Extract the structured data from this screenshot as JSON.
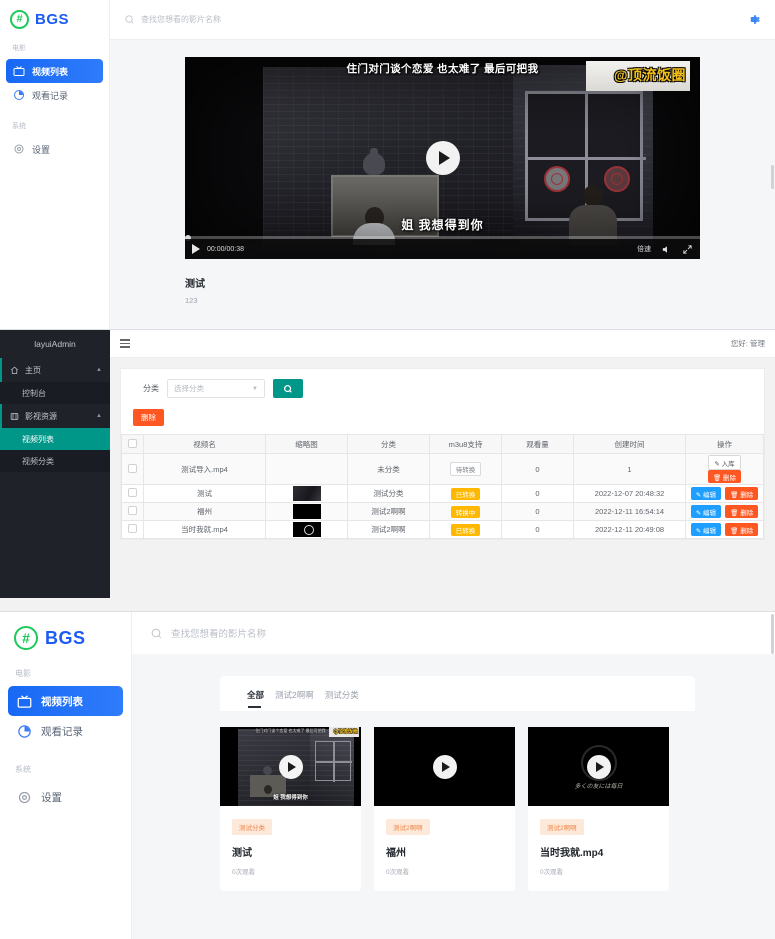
{
  "frontend_detail": {
    "brand": {
      "mark": "#",
      "name": "BGS"
    },
    "sidebar": {
      "groups": [
        {
          "label": "电影",
          "items": [
            {
              "label": "视频列表",
              "icon": "tv-icon",
              "active": true
            },
            {
              "label": "观看记录",
              "icon": "history-pie-icon",
              "active": false
            }
          ]
        },
        {
          "label": "系统",
          "items": [
            {
              "label": "设置",
              "icon": "gear-icon",
              "active": false
            }
          ]
        }
      ]
    },
    "search": {
      "placeholder": "查找您想看的影片名称",
      "icon": "search-icon"
    },
    "settings_icon": "gear-icon",
    "player": {
      "subtitle_top": "住门对门谈个恋爱 也太难了 最后可把我",
      "watermark": "@顶流饭圈",
      "subtitle_bottom": "姐 我想得到你",
      "time": "00:00/00:38",
      "rate_label": "倍速",
      "volume_label": "0",
      "play_icon": "play-icon",
      "volume_icon": "volume-icon",
      "fullscreen_icon": "fullscreen-icon"
    },
    "video": {
      "title": "测试",
      "description": "123"
    }
  },
  "admin": {
    "logo": "layuiAdmin",
    "greeting": "您好: 管理",
    "menu": [
      {
        "label": "主页",
        "icon": "home-icon",
        "expanded": true,
        "children": [
          {
            "label": "控制台",
            "active": false
          }
        ]
      },
      {
        "label": "影视资源",
        "icon": "film-icon",
        "expanded": true,
        "children": [
          {
            "label": "视频列表",
            "active": true
          },
          {
            "label": "视频分类",
            "active": false
          }
        ]
      }
    ],
    "filter": {
      "label": "分类",
      "select_placeholder": "选择分类",
      "search_icon": "search-icon",
      "delete_label": "删除"
    },
    "table": {
      "columns": [
        "视频名",
        "缩略图",
        "分类",
        "m3u8支持",
        "观看量",
        "创建时间",
        "操作"
      ],
      "rows": [
        {
          "name": "测试导入.mp4",
          "thumb": "none",
          "category": "未分类",
          "m3u8": "待转换",
          "m3u8_state": "gray",
          "views": "0",
          "created": "1",
          "action_primary": "入库",
          "action_primary_style": "white",
          "action_delete": "删除"
        },
        {
          "name": "测试",
          "thumb": "scene",
          "category": "测试分类",
          "m3u8": "已转换",
          "m3u8_state": "warn",
          "views": "0",
          "created": "2022-12-07 20:48:32",
          "action_primary": "编辑",
          "action_primary_style": "blue",
          "action_delete": "删除"
        },
        {
          "name": "福州",
          "thumb": "black",
          "category": "测试2啊啊",
          "m3u8": "转换中",
          "m3u8_state": "warn",
          "views": "0",
          "created": "2022-12-11 16:54:14",
          "action_primary": "编辑",
          "action_primary_style": "blue",
          "action_delete": "删除"
        },
        {
          "name": "当时我就.mp4",
          "thumb": "ring",
          "category": "测试2啊啊",
          "m3u8": "已转换",
          "m3u8_state": "warn",
          "views": "0",
          "created": "2022-12-11 20:49:08",
          "action_primary": "编辑",
          "action_primary_style": "blue",
          "action_delete": "删除"
        }
      ]
    }
  },
  "frontend_list": {
    "brand": {
      "mark": "#",
      "name": "BGS"
    },
    "sidebar": {
      "groups": [
        {
          "label": "电影",
          "items": [
            {
              "label": "视频列表",
              "icon": "tv-icon",
              "active": true
            },
            {
              "label": "观看记录",
              "icon": "history-pie-icon",
              "active": false
            }
          ]
        },
        {
          "label": "系统",
          "items": [
            {
              "label": "设置",
              "icon": "gear-icon",
              "active": false
            }
          ]
        }
      ]
    },
    "search": {
      "placeholder": "查找您想看的影片名称",
      "icon": "search-icon"
    },
    "tabs": [
      {
        "label": "全部",
        "active": true
      },
      {
        "label": "测试2啊啊",
        "active": false
      },
      {
        "label": "测试分类",
        "active": false
      }
    ],
    "cards": [
      {
        "tag": "测试分类",
        "title": "测试",
        "views": "0次观看",
        "thumb": "scene",
        "sub_top": "住门对门谈个恋爱 也太难了 最后可把我",
        "sub_bottom": "姐 我想得到你",
        "watermark": "@顶流饭圈"
      },
      {
        "tag": "测试2啊啊",
        "title": "福州",
        "views": "0次观看",
        "thumb": "black",
        "sub_top": "",
        "sub_bottom": "",
        "watermark": ""
      },
      {
        "tag": "测试2啊啊",
        "title": "当时我就.mp4",
        "views": "0次观看",
        "thumb": "ring",
        "sub_top": "",
        "sub_bottom": "",
        "watermark": "",
        "caption": "多くの友には毎日"
      }
    ]
  }
}
